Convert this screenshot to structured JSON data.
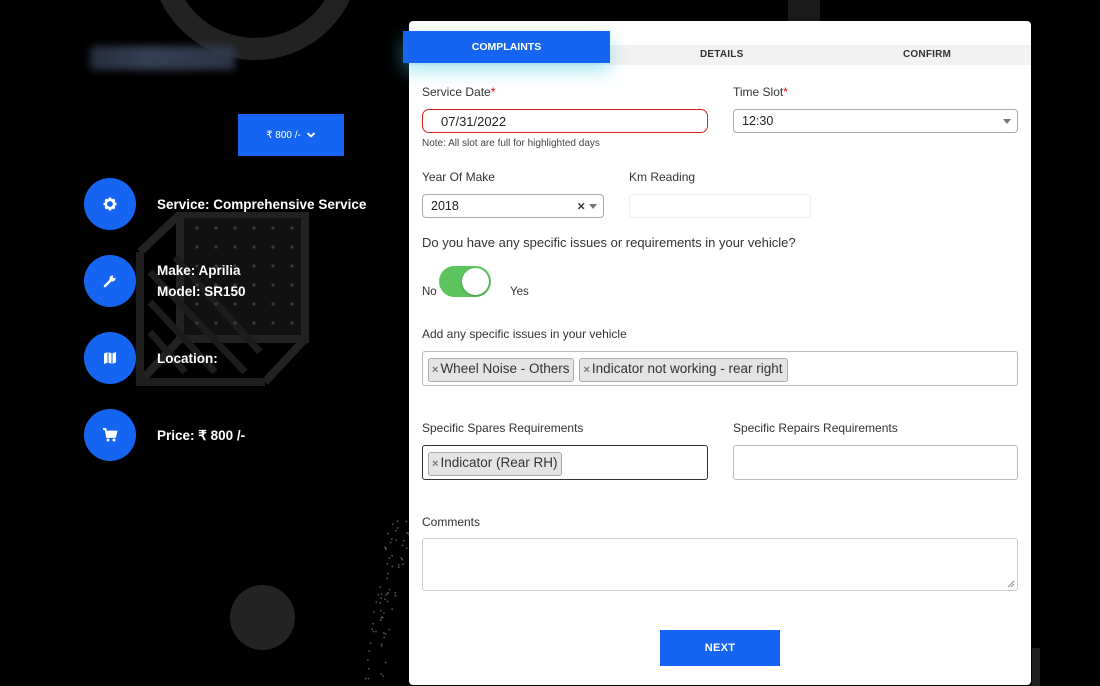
{
  "header": {
    "price_button_label": "₹ 800 /-"
  },
  "summary": {
    "service": "Service: Comprehensive Service",
    "make": "Make: Aprilia",
    "model": "Model: SR150",
    "location": "Location:",
    "price": "Price: ₹ 800 /-"
  },
  "tabs": [
    {
      "label": "COMPLAINTS",
      "active": true
    },
    {
      "label": "DETAILS",
      "active": false
    },
    {
      "label": "CONFIRM",
      "active": false
    }
  ],
  "form": {
    "service_date": {
      "label": "Service Date",
      "required_mark": "*",
      "value": "07/31/2022"
    },
    "time_slot": {
      "label": "Time Slot",
      "required_mark": "*",
      "value": "12:30"
    },
    "slot_note": "Note: All slot are full for highlighted days",
    "year_of_make": {
      "label": "Year Of Make",
      "value": "2018",
      "clear_glyph": "×"
    },
    "km_reading": {
      "label": "Km Reading",
      "value": ""
    },
    "issues_question": "Do you have any specific issues or requirements in your vehicle?",
    "toggle": {
      "off_label": "No",
      "on_label": "Yes",
      "state": "on"
    },
    "specific_issues": {
      "label": "Add any specific issues in your vehicle",
      "tags": [
        "Wheel Noise - Others",
        "Indicator not working - rear right"
      ]
    },
    "spares": {
      "label": "Specific Spares Requirements",
      "tags": [
        "Indicator (Rear RH)"
      ]
    },
    "repairs": {
      "label": "Specific Repairs Requirements",
      "value": ""
    },
    "comments": {
      "label": "Comments",
      "value": ""
    },
    "next_label": "NEXT",
    "tag_remove_glyph": "×"
  },
  "colors": {
    "accent": "#1565f2",
    "toggle_on": "#5cc45c",
    "error_border": "#e02020"
  },
  "icons": [
    "chevron-down-icon",
    "gear-icon",
    "wrench-icon",
    "map-icon",
    "cart-icon",
    "resize-handle-icon"
  ]
}
